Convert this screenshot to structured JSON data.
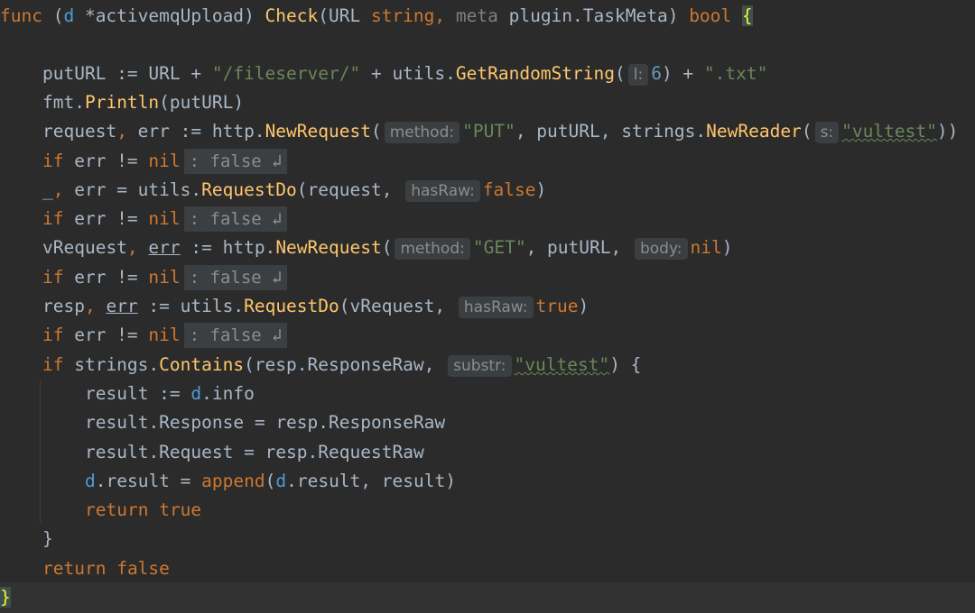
{
  "colors": {
    "background": "#2b2b2b",
    "keyword": "#cc7832",
    "function": "#ffc66d",
    "string": "#6a8759",
    "number": "#6897bb",
    "hint_bg": "#3b3f41",
    "brace_highlight": "#3b514d"
  },
  "code": {
    "l1": {
      "kw": "func",
      "open": " (",
      "recv": "d",
      "star": " *",
      "type": "activemqUpload",
      "close": ") ",
      "name": "Check",
      "p1": "(URL ",
      "t1": "string",
      "comma": ", ",
      "meta": "meta",
      "plugin": " plugin.",
      "tmeta": "TaskMeta",
      "end": ") ",
      "bool": "bool",
      "sp": " ",
      "brace": "{"
    },
    "l2": {
      "a": "putURL := URL + ",
      "s1": "\"/fileserver/\"",
      "b": " + utils.",
      "fn": "GetRandomString",
      "c": "(",
      "hint": "l:",
      "num": "6",
      "d": ") + ",
      "s2": "\".txt\""
    },
    "l3": {
      "a": "fmt.",
      "fn": "Println",
      "b": "(putURL)"
    },
    "l4": {
      "a": "request",
      "c1": ", ",
      "b": "err := http.",
      "fn": "NewRequest",
      "c": "(",
      "hint1": "method:",
      "s1": "\"PUT\"",
      "d": ", putURL, strings.",
      "fn2": "NewReader",
      "e": "(",
      "hint2": "s:",
      "s2": "\"vultest\"",
      "f": "))"
    },
    "l5": {
      "kw": "if",
      "a": " err != ",
      "nil": "nil",
      "fold": ": false ↲"
    },
    "l6": {
      "a": "_",
      "c1": ", ",
      "b": "err = utils.",
      "fn": "RequestDo",
      "c": "(request, ",
      "hint": "hasRaw:",
      "kw": "false",
      "d": ")"
    },
    "l7": {
      "kw": "if",
      "a": " err != ",
      "nil": "nil",
      "fold": ": false ↲"
    },
    "l8": {
      "a": "vRequest",
      "c1": ", ",
      "err": "err",
      "b": " := http.",
      "fn": "NewRequest",
      "c": "(",
      "hint1": "method:",
      "s1": "\"GET\"",
      "d": ", putURL, ",
      "hint2": "body:",
      "nil": "nil",
      "e": ")"
    },
    "l9": {
      "kw": "if",
      "a": " err != ",
      "nil": "nil",
      "fold": ": false ↲"
    },
    "l10": {
      "a": "resp",
      "c1": ", ",
      "err": "err",
      "b": " := utils.",
      "fn": "RequestDo",
      "c": "(vRequest, ",
      "hint": "hasRaw:",
      "kw": "true",
      "d": ")"
    },
    "l11": {
      "kw": "if",
      "a": " err != ",
      "nil": "nil",
      "fold": ": false ↲"
    },
    "l12": {
      "kw": "if",
      "a": " strings.",
      "fn": "Contains",
      "b": "(resp.ResponseRaw, ",
      "hint": "substr:",
      "s": "\"vultest\"",
      "c": ") {"
    },
    "l13": {
      "a": "result := ",
      "d": "d",
      "b": ".info"
    },
    "l14": {
      "a": "result.Response = resp.ResponseRaw"
    },
    "l15": {
      "a": "result.Request = resp.RequestRaw"
    },
    "l16": {
      "d": "d",
      "a": ".result = ",
      "fn": "append",
      "b": "(",
      "d2": "d",
      "c": ".result, result)"
    },
    "l17": {
      "kw": "return",
      "sp": " ",
      "kw2": "true"
    },
    "l18": {
      "a": "}"
    },
    "l19": {
      "kw": "return",
      "sp": " ",
      "kw2": "false"
    },
    "l20": {
      "brace": "}"
    }
  }
}
